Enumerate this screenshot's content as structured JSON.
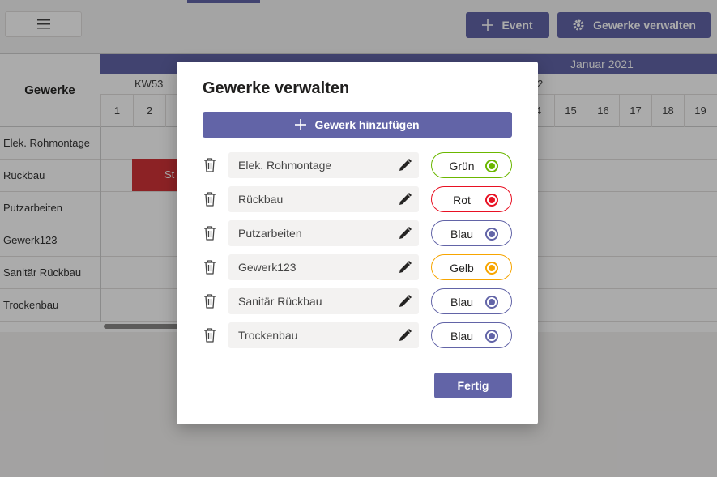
{
  "toolbar": {
    "event_button": "Event",
    "manage_button": "Gewerke verwalten"
  },
  "calendar": {
    "trades_header": "Gewerke",
    "month": "Januar 2021",
    "weeks": [
      "KW53",
      "KW2"
    ],
    "days": [
      "1",
      "2",
      "4",
      "15",
      "16",
      "17",
      "18",
      "19"
    ],
    "trades": [
      "Elek. Rohmontage",
      "Rückbau",
      "Putzarbeiten",
      "Gewerk123",
      "Sanitär Rückbau",
      "Trockenbau"
    ],
    "event_bar_text": "St"
  },
  "modal": {
    "title": "Gewerke verwalten",
    "add_button": "Gewerk hinzufügen",
    "done_button": "Fertig",
    "items": [
      {
        "name": "Elek. Rohmontage",
        "color_label": "Grün",
        "color": "#6bb700"
      },
      {
        "name": "Rückbau",
        "color_label": "Rot",
        "color": "#e81123"
      },
      {
        "name": "Putzarbeiten",
        "color_label": "Blau",
        "color": "#6264a7"
      },
      {
        "name": "Gewerk123",
        "color_label": "Gelb",
        "color": "#f7a500"
      },
      {
        "name": "Sanitär Rückbau",
        "color_label": "Blau",
        "color": "#6264a7"
      },
      {
        "name": "Trockenbau",
        "color_label": "Blau",
        "color": "#6264a7"
      }
    ]
  },
  "colors": {
    "accent": "#6264a7",
    "event_bar": "#d13438"
  }
}
